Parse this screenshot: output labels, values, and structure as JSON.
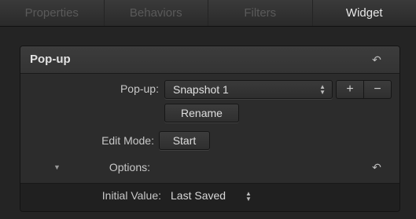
{
  "tabs": [
    {
      "label": "Properties",
      "active": false
    },
    {
      "label": "Behaviors",
      "active": false
    },
    {
      "label": "Filters",
      "active": false
    },
    {
      "label": "Widget",
      "active": true
    }
  ],
  "section": {
    "title": "Pop-up",
    "reset_icon": "reset-arrow-icon"
  },
  "popup_row": {
    "label": "Pop-up:",
    "selected": "Snapshot 1",
    "add_label": "+",
    "remove_label": "−"
  },
  "rename_button": "Rename",
  "edit_mode": {
    "label": "Edit Mode:",
    "button": "Start"
  },
  "options": {
    "label": "Options:",
    "disclosure": "▼"
  },
  "initial_value": {
    "label": "Initial Value:",
    "value": "Last Saved"
  },
  "colors": {
    "background": "#1c1c1c",
    "panel": "#2c2c2c",
    "text": "#d6d6d6",
    "inactive_tab": "#5a5a5a"
  }
}
